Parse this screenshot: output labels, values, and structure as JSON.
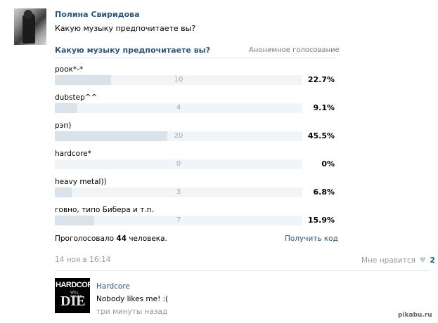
{
  "post": {
    "author": "Полина Свиридова",
    "text": "Какую музыку предпочитаете вы?"
  },
  "poll": {
    "title": "Какую музыку предпочитаете вы?",
    "type": "Анонимное голосование",
    "options": [
      {
        "label": "роок*-*",
        "count": "10",
        "percent": "22.7%",
        "fill": 0.227
      },
      {
        "label": "dubstep^^",
        "count": "4",
        "percent": "9.1%",
        "fill": 0.091
      },
      {
        "label": "рэп)",
        "count": "20",
        "percent": "45.5%",
        "fill": 0.455
      },
      {
        "label": "hardcore*",
        "count": "0",
        "percent": "0%",
        "fill": 0
      },
      {
        "label": "heavy metal))",
        "count": "3",
        "percent": "6.8%",
        "fill": 0.068
      },
      {
        "label": "говно, типо Бибера и т.п.",
        "count": "7",
        "percent": "15.9%",
        "fill": 0.159
      }
    ],
    "voted_prefix": "Проголосовало",
    "voted_count": "44",
    "voted_suffix": "человека.",
    "get_code": "Получить код"
  },
  "meta": {
    "date": "14 ноя в 16:14",
    "like_label": "Мне нравится",
    "like_count": "2"
  },
  "comment": {
    "author": "Hardcore",
    "text": "Nobody likes me! :(",
    "time": "три минуты назад",
    "avatar_line1": "HARDCORE",
    "avatar_line2": "WILL NEVER",
    "avatar_line3": "DIE"
  },
  "watermark": "pikabu.ru",
  "colors": {
    "link": "#2b587a",
    "bar_fill": "#dae2ea",
    "bar_track": "#f2f5f8"
  }
}
